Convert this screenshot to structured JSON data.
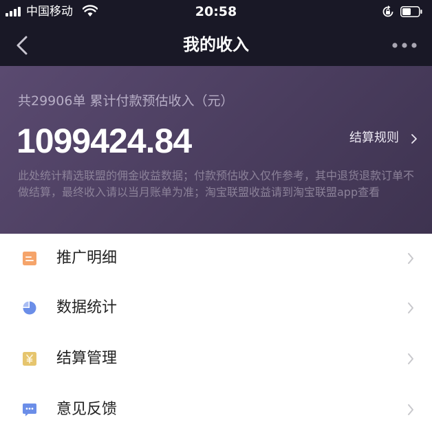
{
  "status_bar": {
    "carrier": "中国移动",
    "time": "20:58"
  },
  "nav": {
    "title": "我的收入"
  },
  "summary": {
    "caption": "共29906单 累计付款预估收入（元）",
    "amount": "1099424.84",
    "rules_link": "结算规则",
    "note": "此处统计精选联盟的佣金收益数据；付款预估收入仅作参考，其中退货退款订单不做结算，最终收入请以当月账单为准；淘宝联盟收益请到淘宝联盟app查看"
  },
  "menu": {
    "items": [
      {
        "label": "推广明细",
        "icon": "document-list-icon",
        "color": "#f5a46a"
      },
      {
        "label": "数据统计",
        "icon": "pie-chart-icon",
        "color": "#6b8ee8"
      },
      {
        "label": "结算管理",
        "icon": "yuan-icon",
        "color": "#e6c56e"
      },
      {
        "label": "意见反馈",
        "icon": "chat-bubble-icon",
        "color": "#6b8ee8"
      }
    ]
  },
  "colors": {
    "nav_background": "#191826",
    "hero_gradient_start": "#5a4a70",
    "hero_gradient_end": "#3e3350"
  }
}
